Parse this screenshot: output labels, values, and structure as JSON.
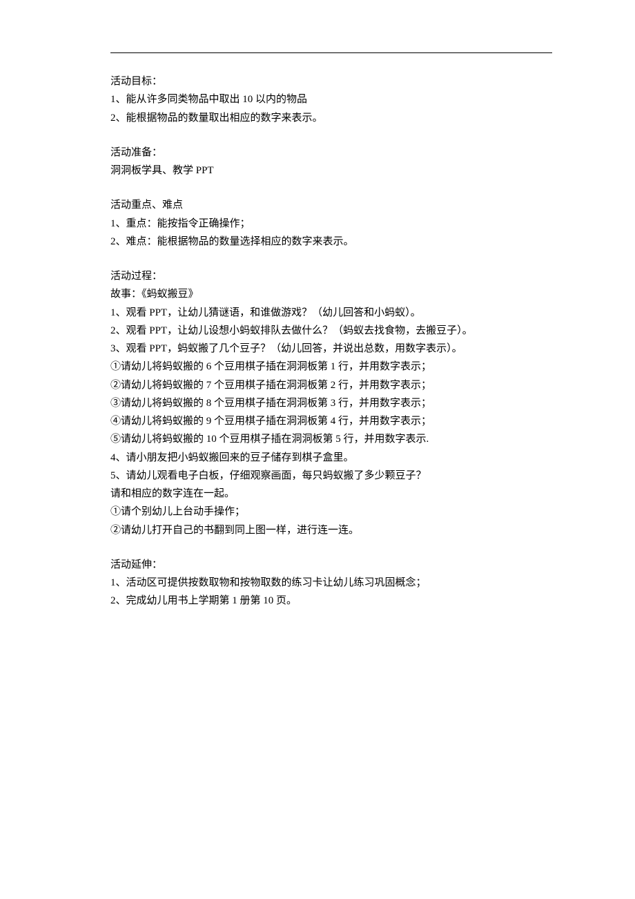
{
  "sections": {
    "goals": {
      "title": "活动目标：",
      "items": [
        "1、能从许多同类物品中取出 10 以内的物品",
        "2、能根据物品的数量取出相应的数字来表示。"
      ]
    },
    "preparation": {
      "title": "活动准备：",
      "items": [
        "洞洞板学具、教学 PPT"
      ]
    },
    "focus": {
      "title": "活动重点、难点",
      "items": [
        "1、重点：能按指令正确操作；",
        "2、难点：能根据物品的数量选择相应的数字来表示。"
      ]
    },
    "process": {
      "title": "活动过程：",
      "story": "故事：《蚂蚁搬豆》",
      "items": [
        "1、观看 PPT，让幼儿猜谜语，和谁做游戏？（幼儿回答和小蚂蚁）。",
        "2、观看 PPT，让幼儿设想小蚂蚁排队去做什么？（蚂蚁去找食物，去搬豆子）。",
        "3、观看 PPT，蚂蚁搬了几个豆子？（幼儿回答，并说出总数，用数字表示）。",
        "①请幼儿将蚂蚁搬的 6 个豆用棋子插在洞洞板第 1 行，并用数字表示；",
        "②请幼儿将蚂蚁搬的 7 个豆用棋子插在洞洞板第 2 行，并用数字表示；",
        "③请幼儿将蚂蚁搬的 8 个豆用棋子插在洞洞板第 3 行，并用数字表示；",
        "④请幼儿将蚂蚁搬的 9 个豆用棋子插在洞洞板第 4 行，并用数字表示；",
        "⑤请幼儿将蚂蚁搬的 10 个豆用棋子插在洞洞板第 5 行，并用数字表示.",
        "4、请小朋友把小蚂蚁搬回来的豆子储存到棋子盒里。",
        "5、请幼儿观看电子白板，仔细观察画面，每只蚂蚁搬了多少颗豆子？",
        "请和相应的数字连在一起。",
        "①请个别幼儿上台动手操作；",
        "②请幼儿打开自己的书翻到同上图一样，进行连一连。"
      ]
    },
    "extension": {
      "title": "活动延伸：",
      "items": [
        "1、活动区可提供按数取物和按物取数的练习卡让幼儿练习巩固概念；",
        "2、完成幼儿用书上学期第 1 册第 10 页。"
      ]
    }
  }
}
